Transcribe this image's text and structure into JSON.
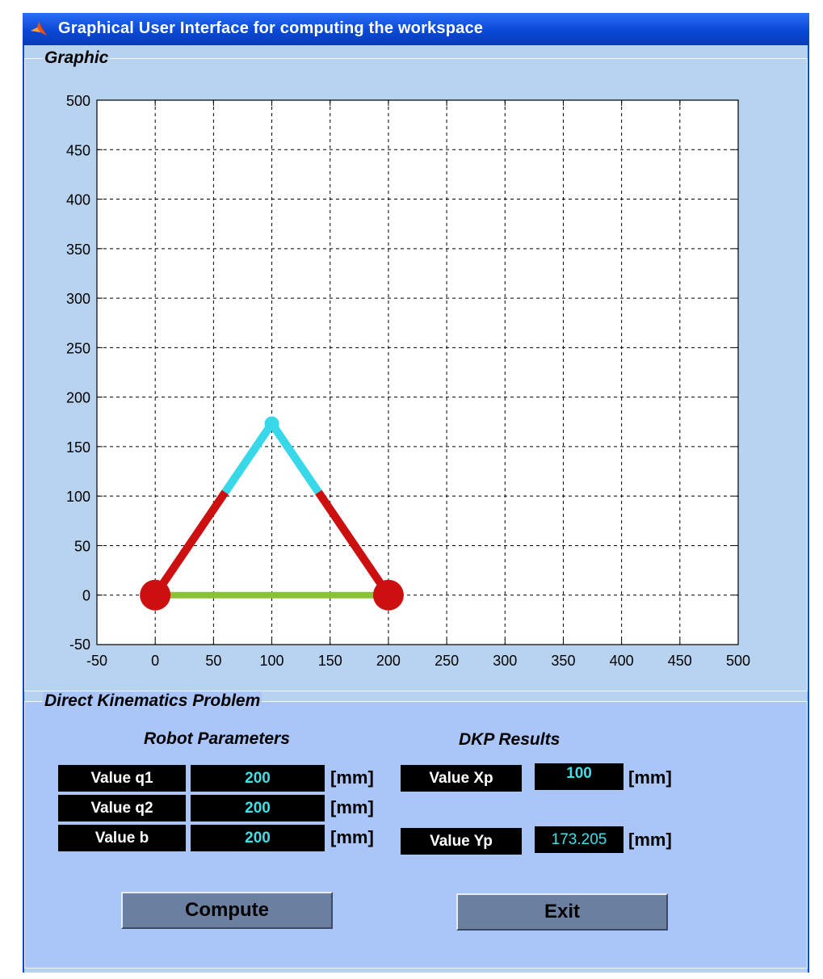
{
  "window": {
    "title": "Graphical User Interface for computing the workspace"
  },
  "panels": {
    "graphic_title": "Graphic",
    "dkp_title": "Direct Kinematics Problem"
  },
  "colors": {
    "cyan": "#38d8e8",
    "red": "#cc1010",
    "green": "#88c23a"
  },
  "chart_data": {
    "type": "line",
    "title": "",
    "xlabel": "",
    "ylabel": "",
    "xlim": [
      -50,
      500
    ],
    "ylim": [
      -50,
      500
    ],
    "grid": true,
    "x_ticks": [
      -50,
      0,
      50,
      100,
      150,
      200,
      250,
      300,
      350,
      400,
      450,
      500
    ],
    "y_ticks": [
      -50,
      0,
      50,
      100,
      150,
      200,
      250,
      300,
      350,
      400,
      450,
      500
    ],
    "series": [
      {
        "color": "#88c23a",
        "points": [
          [
            0,
            0
          ],
          [
            200,
            0
          ]
        ]
      },
      {
        "color": "#cc1010",
        "points": [
          [
            0,
            0
          ],
          [
            60,
            104
          ]
        ]
      },
      {
        "color": "#38d8e8",
        "points": [
          [
            60,
            104
          ],
          [
            100,
            173.205
          ]
        ]
      },
      {
        "color": "#cc1010",
        "points": [
          [
            200,
            0
          ],
          [
            140,
            104
          ]
        ]
      },
      {
        "color": "#38d8e8",
        "points": [
          [
            140,
            104
          ],
          [
            100,
            173.205
          ]
        ]
      }
    ],
    "markers": [
      {
        "x": 0,
        "y": 0,
        "color": "#cc1010",
        "size": "large"
      },
      {
        "x": 200,
        "y": 0,
        "color": "#cc1010",
        "size": "large"
      },
      {
        "x": 100,
        "y": 173.205,
        "color": "#38d8e8",
        "size": "small"
      }
    ]
  },
  "dkp": {
    "robot_params_heading": "Robot Parameters",
    "results_heading": "DKP Results",
    "params": [
      {
        "label": "Value q1",
        "value": "200",
        "unit": "[mm]"
      },
      {
        "label": "Value q2",
        "value": "200",
        "unit": "[mm]"
      },
      {
        "label": "Value b",
        "value": "200",
        "unit": "[mm]"
      }
    ],
    "results": [
      {
        "label": "Value Xp",
        "value": "100",
        "unit": "[mm]"
      },
      {
        "label": "Value Yp",
        "value": "173.205",
        "unit": "[mm]"
      }
    ],
    "compute_label": "Compute",
    "exit_label": "Exit"
  }
}
